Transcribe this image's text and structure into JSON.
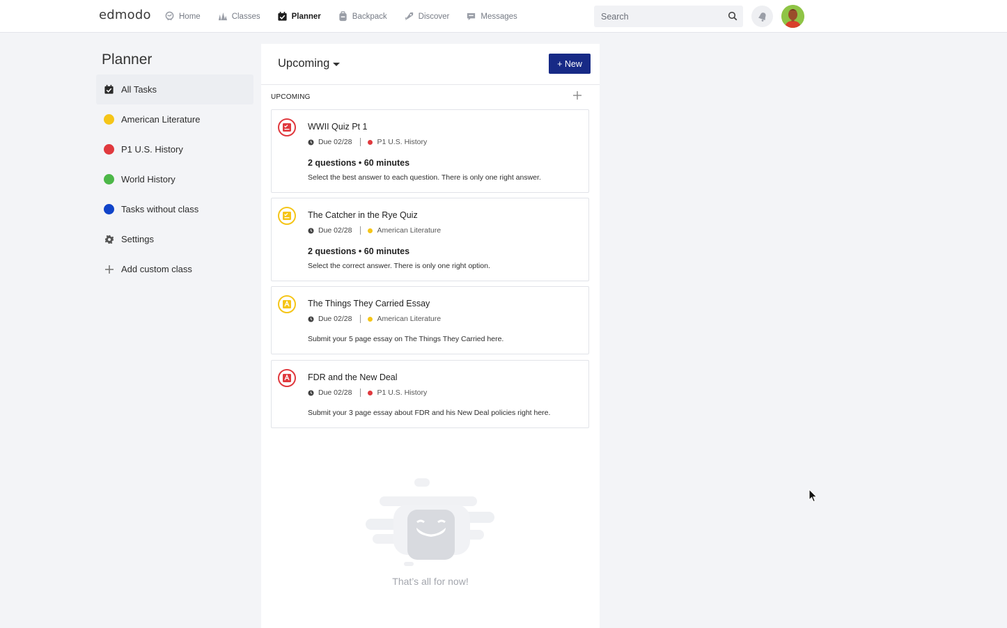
{
  "nav": {
    "logo": "edmodo",
    "items": [
      {
        "label": "Home",
        "icon": "home-icon",
        "active": false
      },
      {
        "label": "Classes",
        "icon": "classes-icon",
        "active": false
      },
      {
        "label": "Planner",
        "icon": "planner-icon",
        "active": true
      },
      {
        "label": "Backpack",
        "icon": "backpack-icon",
        "active": false
      },
      {
        "label": "Discover",
        "icon": "discover-icon",
        "active": false
      },
      {
        "label": "Messages",
        "icon": "messages-icon",
        "active": false
      }
    ],
    "search_placeholder": "Search"
  },
  "sidebar": {
    "title": "Planner",
    "items": [
      {
        "label": "All Tasks",
        "icon": "calendar-check-icon",
        "active": true
      },
      {
        "label": "American Literature",
        "color": "#f5c518"
      },
      {
        "label": "P1 U.S. History",
        "color": "#e0393e"
      },
      {
        "label": "World History",
        "color": "#4cb748"
      },
      {
        "label": "Tasks without class",
        "color": "#1043c9"
      },
      {
        "label": "Settings",
        "icon": "gear-icon"
      },
      {
        "label": "Add custom class",
        "icon": "plus-icon"
      }
    ]
  },
  "main": {
    "filter_label": "Upcoming",
    "new_button": "+ New",
    "section_label": "UPCOMING",
    "tasks": [
      {
        "title": "WWII Quiz Pt 1",
        "due": "Due 02/28",
        "class": "P1 U.S. History",
        "class_color": "#e0393e",
        "type": "quiz",
        "icon_color": "#e0393e",
        "details": "2 questions • 60 minutes",
        "description": "Select the best answer to each question. There is only one right answer."
      },
      {
        "title": "The Catcher in the Rye Quiz",
        "due": "Due 02/28",
        "class": "American Literature",
        "class_color": "#f5c518",
        "type": "quiz",
        "icon_color": "#f5c518",
        "details": "2 questions • 60 minutes",
        "description": "Select the correct answer. There is only one right option."
      },
      {
        "title": "The Things They Carried Essay",
        "due": "Due 02/28",
        "class": "American Literature",
        "class_color": "#f5c518",
        "type": "assignment",
        "icon_color": "#f5c518",
        "details": "",
        "description": "Submit your 5 page essay on The Things They Carried here."
      },
      {
        "title": "FDR and the New Deal",
        "due": "Due 02/28",
        "class": "P1 U.S. History",
        "class_color": "#e0393e",
        "type": "assignment",
        "icon_color": "#e0393e",
        "details": "",
        "description": "Submit your 3 page essay about FDR and his New Deal policies right here."
      }
    ],
    "empty_message": "That’s all for now!"
  }
}
